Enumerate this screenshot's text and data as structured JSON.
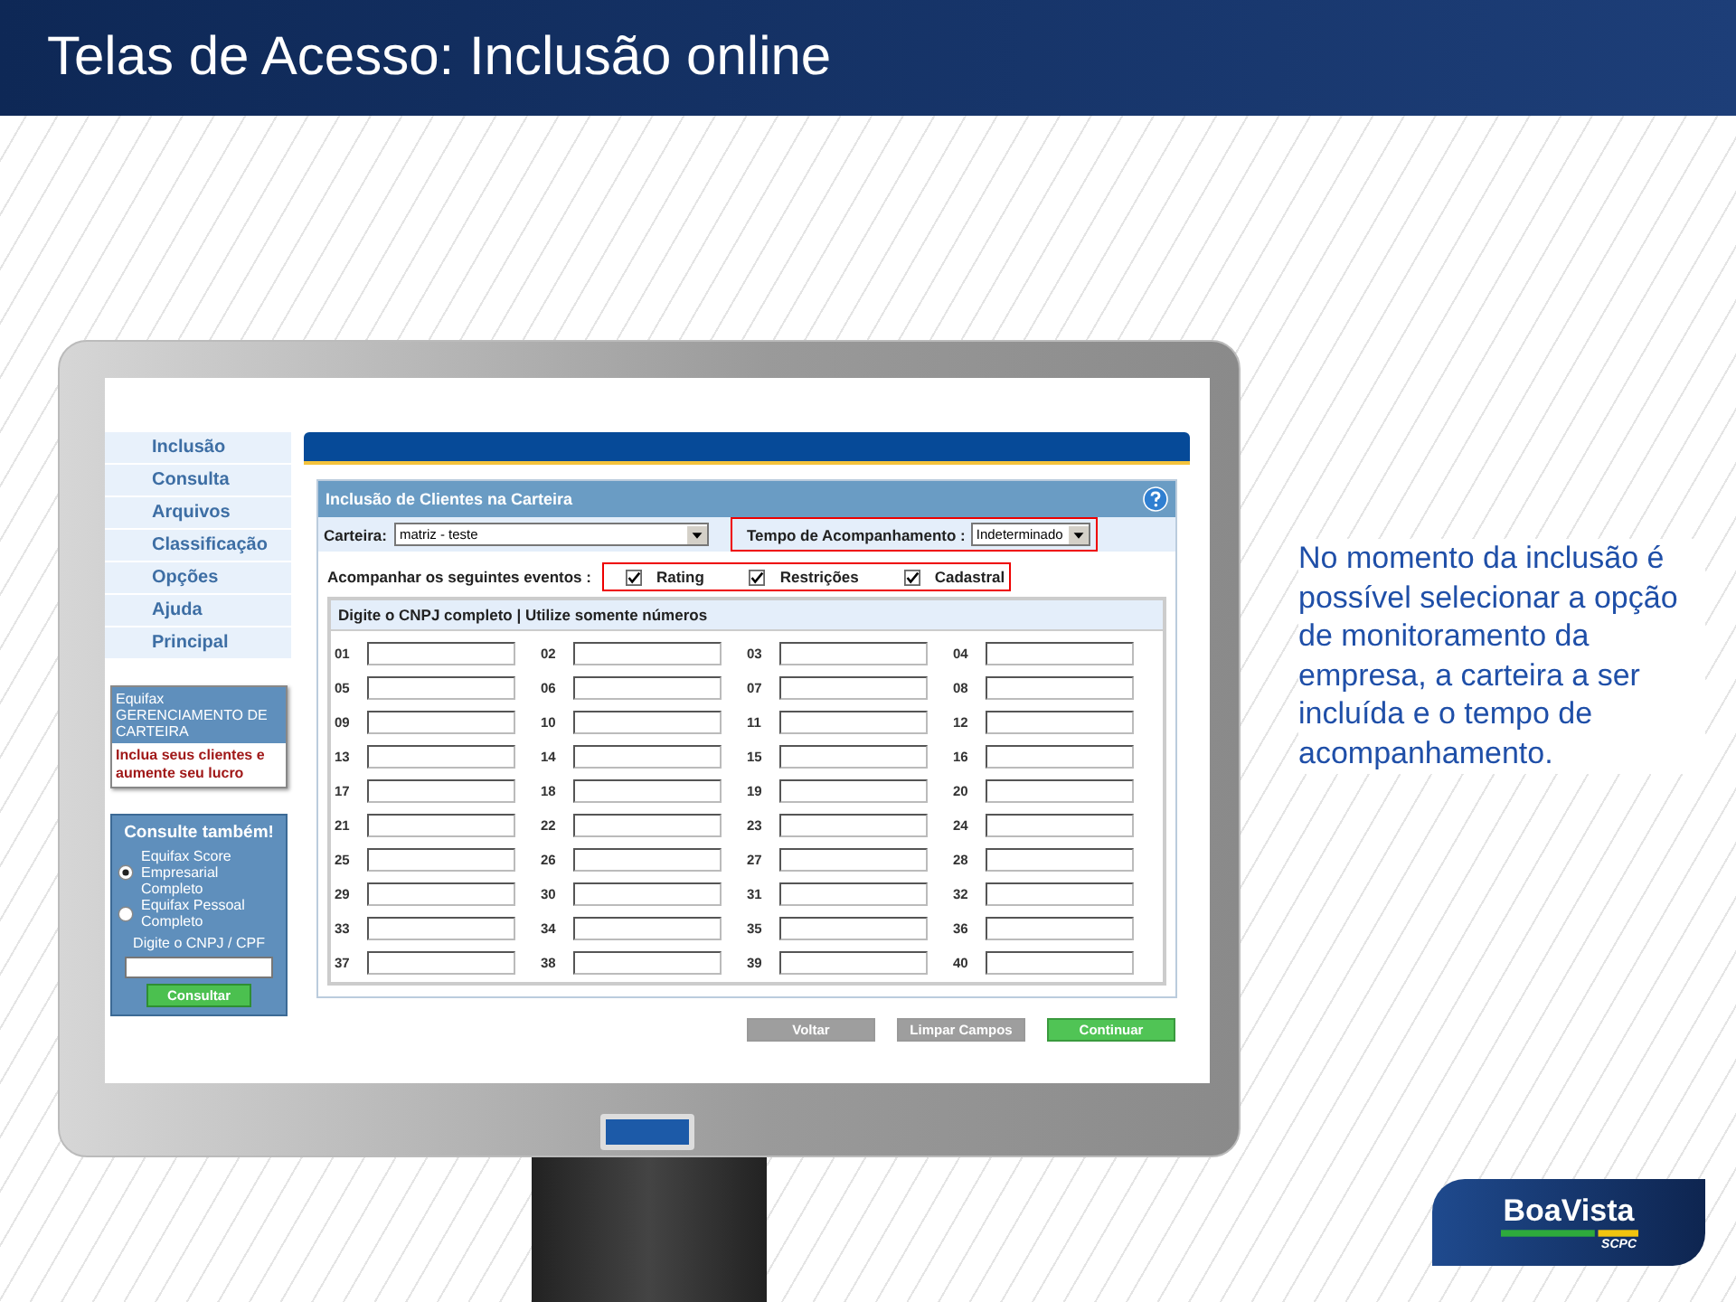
{
  "slide_title": "Telas de Acesso: Inclusão online",
  "sidebar": {
    "items": [
      {
        "label": "Inclusão"
      },
      {
        "label": "Consulta"
      },
      {
        "label": "Arquivos"
      },
      {
        "label": "Classificação"
      },
      {
        "label": "Opções"
      },
      {
        "label": "Ajuda"
      },
      {
        "label": "Principal"
      }
    ],
    "promo": {
      "heading": "Equifax GERENCIAMENTO DE CARTEIRA",
      "text": "Inclua seus clientes e aumente seu lucro"
    },
    "consult": {
      "title": "Consulte também!",
      "options": [
        {
          "label": "Equifax Score Empresarial Completo",
          "selected": true
        },
        {
          "label": "Equifax Pessoal Completo",
          "selected": false
        }
      ],
      "field_label": "Digite o CNPJ / CPF",
      "button": "Consultar"
    }
  },
  "panel": {
    "title": "Inclusão de Clientes na Carteira",
    "carteira_label": "Carteira:",
    "carteira_value": "matriz - teste",
    "tempo_label": "Tempo de Acompanhamento :",
    "tempo_value": "Indeterminado",
    "events_label": "Acompanhar os seguintes eventos :",
    "events": [
      {
        "label": "Rating",
        "checked": true
      },
      {
        "label": "Restrições",
        "checked": true
      },
      {
        "label": "Cadastral",
        "checked": true
      }
    ],
    "fields_header": "Digite o CNPJ completo | Utilize somente números",
    "fields": [
      "01",
      "02",
      "03",
      "04",
      "05",
      "06",
      "07",
      "08",
      "09",
      "10",
      "11",
      "12",
      "13",
      "14",
      "15",
      "16",
      "17",
      "18",
      "19",
      "20",
      "21",
      "22",
      "23",
      "24",
      "25",
      "26",
      "27",
      "28",
      "29",
      "30",
      "31",
      "32",
      "33",
      "34",
      "35",
      "36",
      "37",
      "38",
      "39",
      "40"
    ],
    "buttons": [
      {
        "label": "Voltar",
        "kind": "secondary"
      },
      {
        "label": "Limpar Campos",
        "kind": "secondary"
      },
      {
        "label": "Continuar",
        "kind": "primary"
      }
    ]
  },
  "description": "No momento da inclusão é possível selecionar a opção de monitoramento da empresa, a carteira a ser incluída e o tempo de acompanhamento.",
  "logo": {
    "name": "BoaVista",
    "tagline": "SCPC"
  }
}
